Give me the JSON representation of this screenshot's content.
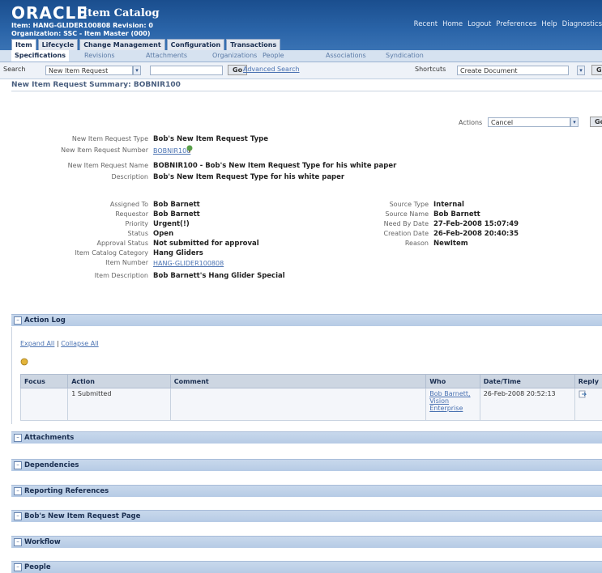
{
  "header": {
    "logo": "ORACLE",
    "app_title": "Item Catalog",
    "item_line": "Item: HANG-GLIDER100808 Revision: 0",
    "org_line": "Organization: SSC - Item Master (000)",
    "global_links": [
      "Recent",
      "Home",
      "Logout",
      "Preferences",
      "Help",
      "Diagnostics"
    ]
  },
  "tabs": [
    "Item",
    "Lifecycle",
    "Change Management",
    "Configuration",
    "Transactions"
  ],
  "subtabs": [
    "Specifications",
    "Revisions",
    "Attachments",
    "Organizations",
    "People",
    "Associations",
    "Syndication"
  ],
  "search": {
    "label": "Search",
    "type_value": "New Item Request",
    "go_label": "Go",
    "advanced_label": "Advanced Search",
    "shortcuts_label": "Shortcuts",
    "shortcuts_value": "Create Document",
    "shortcuts_go": "Go"
  },
  "page_title": "New Item Request Summary: BOBNIR100",
  "actions": {
    "label": "Actions",
    "value": "Cancel",
    "go_label": "Go"
  },
  "request": {
    "type_label": "New Item Request Type",
    "type_value": "Bob's New Item Request Type",
    "number_label": "New Item Request Number",
    "number_value": "BOBNIR100",
    "name_label": "New Item Request Name",
    "name_value": "BOBNIR100 - Bob's New Item Request Type for his white paper",
    "desc_label": "Description",
    "desc_value": "Bob's New Item Request Type for his white paper"
  },
  "details_left": [
    {
      "label": "Assigned To",
      "value": "Bob Barnett",
      "style": "bold"
    },
    {
      "label": "Requestor",
      "value": "Bob Barnett",
      "style": "bold"
    },
    {
      "label": "Priority",
      "value": "Urgent(!)",
      "style": "bold"
    },
    {
      "label": "Status",
      "value": "Open",
      "style": "bold"
    },
    {
      "label": "Approval Status",
      "value": "Not submitted for approval",
      "style": "bold"
    },
    {
      "label": "Item Catalog Category",
      "value": "Hang Gliders",
      "style": "bold"
    },
    {
      "label": "Item Number",
      "value": "HANG-GLIDER100808",
      "style": "link"
    },
    {
      "label": "Item Description",
      "value": "Bob Barnett's Hang Glider Special",
      "style": "bold"
    }
  ],
  "details_right": [
    {
      "label": "Source Type",
      "value": "Internal"
    },
    {
      "label": "Source Name",
      "value": "Bob Barnett"
    },
    {
      "label": "Need By Date",
      "value": "27-Feb-2008 15:07:49"
    },
    {
      "label": "Creation Date",
      "value": "26-Feb-2008 20:40:35"
    },
    {
      "label": "Reason",
      "value": "NewItem"
    }
  ],
  "action_log": {
    "title": "Action Log",
    "expand_all": "Expand All",
    "collapse_all": "Collapse All",
    "columns": [
      "Focus",
      "Action",
      "Comment",
      "Who",
      "Date/Time",
      "Reply"
    ],
    "rows": [
      {
        "focus": "",
        "num": "1",
        "action": "Submitted",
        "comment": "",
        "who": "Bob Barnett, Vision Enterprise",
        "datetime": "26-Feb-2008 20:52:13"
      }
    ]
  },
  "sections": [
    "Attachments",
    "Dependencies",
    "Reporting References",
    "Bob's New Item Request Page",
    "Workflow",
    "People"
  ],
  "colors": {
    "header_blue": "#1a4e8e",
    "section_blue": "#c8d8ec",
    "link": "#4a72b2"
  }
}
